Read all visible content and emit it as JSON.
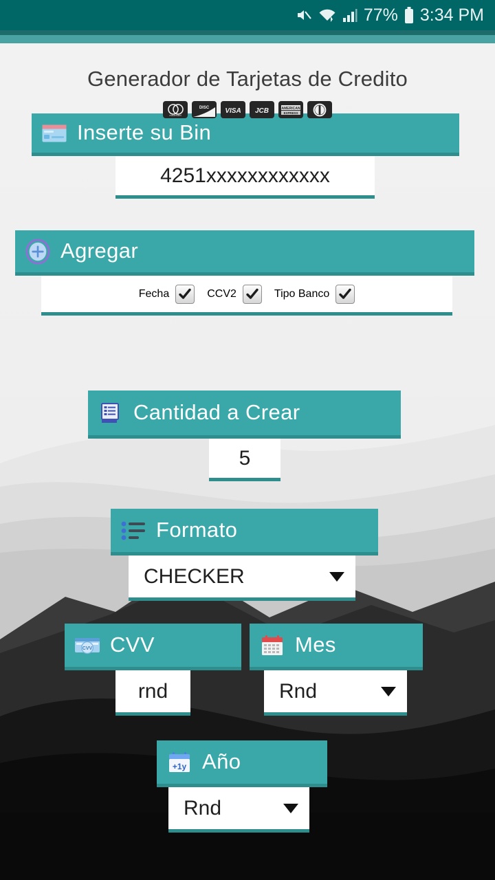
{
  "status_bar": {
    "mute_icon": "mute-icon",
    "wifi_icon": "wifi-icon",
    "signal_icon": "cellular-signal-icon",
    "battery_percent": "77%",
    "battery_icon": "battery-icon",
    "time": "3:34 PM",
    "background_color": "#006666"
  },
  "header": {
    "title": "Generador de Tarjetas de Credito",
    "card_brands": [
      {
        "name": "mastercard",
        "label": "mastercard"
      },
      {
        "name": "discover",
        "label": "DISCOVER"
      },
      {
        "name": "visa",
        "label": "VISA"
      },
      {
        "name": "jcb",
        "label": "JCB"
      },
      {
        "name": "amex",
        "label": "AMERICAN EXPRESS"
      },
      {
        "name": "diners-club",
        "label": "Diners Club"
      }
    ]
  },
  "theme": {
    "teal": "#3aa8a8",
    "teal_dark": "#2e8e8e",
    "status_teal": "#006666",
    "page_bg": "#f1f1f1"
  },
  "fields": {
    "bin": {
      "label": "Inserte su Bin",
      "icon": "credit-card-icon",
      "value": "4251xxxxxxxxxxxx",
      "placeholder": "Inserte su Bin"
    },
    "agregar": {
      "label": "Agregar",
      "icon": "plus-circle-icon",
      "checkboxes": [
        {
          "label": "Fecha",
          "checked": true
        },
        {
          "label": "CCV2",
          "checked": true
        },
        {
          "label": "Tipo Banco",
          "checked": true
        }
      ]
    },
    "cantidad": {
      "label": "Cantidad a Crear",
      "icon": "list-document-icon",
      "value": "5",
      "placeholder": "5"
    },
    "formato": {
      "label": "Formato",
      "icon": "bulleted-list-icon",
      "value": "CHECKER",
      "caret": "chevron-down-icon"
    },
    "cvv": {
      "label": "CVV",
      "icon": "cvv-card-icon",
      "value": "rnd",
      "placeholder": "rnd"
    },
    "mes": {
      "label": "Mes",
      "icon": "calendar-icon",
      "value": "Rnd",
      "caret": "chevron-down-icon"
    },
    "ano": {
      "label": "Año",
      "icon": "calendar-plus-year-icon",
      "value": "Rnd",
      "caret": "chevron-down-icon"
    }
  }
}
